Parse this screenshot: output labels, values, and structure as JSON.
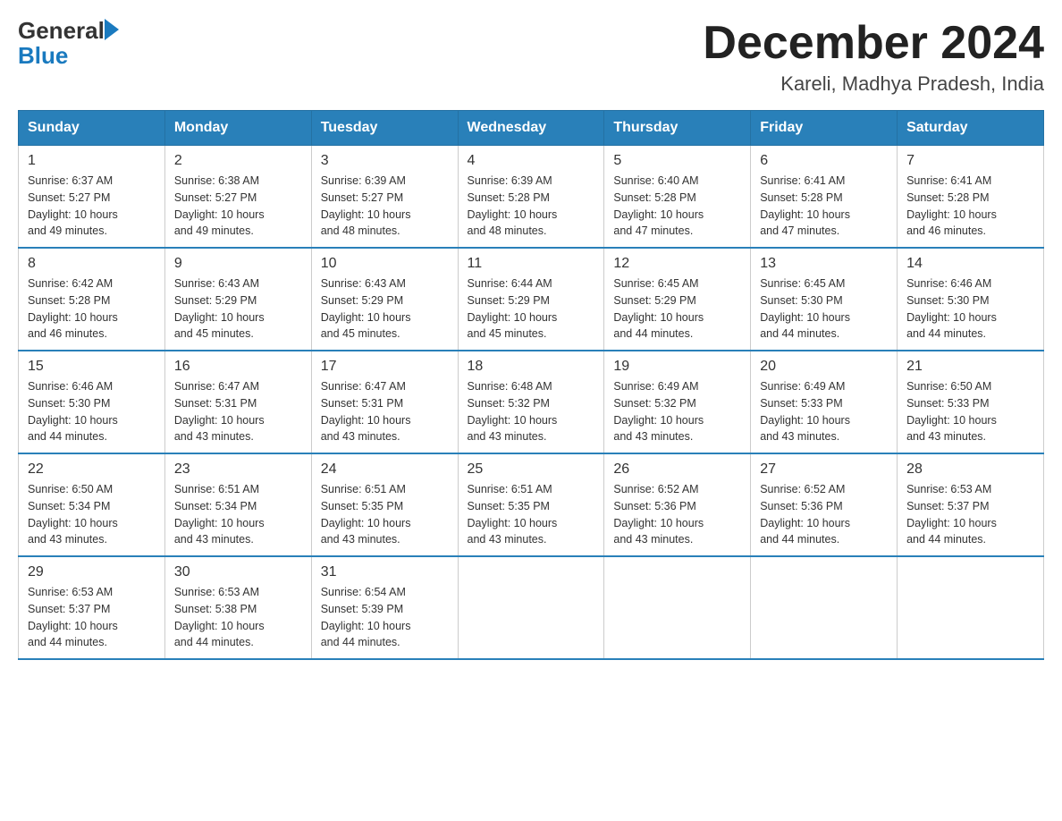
{
  "header": {
    "logo_general": "General",
    "logo_blue": "Blue",
    "month_title": "December 2024",
    "location": "Kareli, Madhya Pradesh, India"
  },
  "days_of_week": [
    "Sunday",
    "Monday",
    "Tuesday",
    "Wednesday",
    "Thursday",
    "Friday",
    "Saturday"
  ],
  "weeks": [
    [
      {
        "day": "1",
        "sunrise": "6:37 AM",
        "sunset": "5:27 PM",
        "daylight": "10 hours and 49 minutes."
      },
      {
        "day": "2",
        "sunrise": "6:38 AM",
        "sunset": "5:27 PM",
        "daylight": "10 hours and 49 minutes."
      },
      {
        "day": "3",
        "sunrise": "6:39 AM",
        "sunset": "5:27 PM",
        "daylight": "10 hours and 48 minutes."
      },
      {
        "day": "4",
        "sunrise": "6:39 AM",
        "sunset": "5:28 PM",
        "daylight": "10 hours and 48 minutes."
      },
      {
        "day": "5",
        "sunrise": "6:40 AM",
        "sunset": "5:28 PM",
        "daylight": "10 hours and 47 minutes."
      },
      {
        "day": "6",
        "sunrise": "6:41 AM",
        "sunset": "5:28 PM",
        "daylight": "10 hours and 47 minutes."
      },
      {
        "day": "7",
        "sunrise": "6:41 AM",
        "sunset": "5:28 PM",
        "daylight": "10 hours and 46 minutes."
      }
    ],
    [
      {
        "day": "8",
        "sunrise": "6:42 AM",
        "sunset": "5:28 PM",
        "daylight": "10 hours and 46 minutes."
      },
      {
        "day": "9",
        "sunrise": "6:43 AM",
        "sunset": "5:29 PM",
        "daylight": "10 hours and 45 minutes."
      },
      {
        "day": "10",
        "sunrise": "6:43 AM",
        "sunset": "5:29 PM",
        "daylight": "10 hours and 45 minutes."
      },
      {
        "day": "11",
        "sunrise": "6:44 AM",
        "sunset": "5:29 PM",
        "daylight": "10 hours and 45 minutes."
      },
      {
        "day": "12",
        "sunrise": "6:45 AM",
        "sunset": "5:29 PM",
        "daylight": "10 hours and 44 minutes."
      },
      {
        "day": "13",
        "sunrise": "6:45 AM",
        "sunset": "5:30 PM",
        "daylight": "10 hours and 44 minutes."
      },
      {
        "day": "14",
        "sunrise": "6:46 AM",
        "sunset": "5:30 PM",
        "daylight": "10 hours and 44 minutes."
      }
    ],
    [
      {
        "day": "15",
        "sunrise": "6:46 AM",
        "sunset": "5:30 PM",
        "daylight": "10 hours and 44 minutes."
      },
      {
        "day": "16",
        "sunrise": "6:47 AM",
        "sunset": "5:31 PM",
        "daylight": "10 hours and 43 minutes."
      },
      {
        "day": "17",
        "sunrise": "6:47 AM",
        "sunset": "5:31 PM",
        "daylight": "10 hours and 43 minutes."
      },
      {
        "day": "18",
        "sunrise": "6:48 AM",
        "sunset": "5:32 PM",
        "daylight": "10 hours and 43 minutes."
      },
      {
        "day": "19",
        "sunrise": "6:49 AM",
        "sunset": "5:32 PM",
        "daylight": "10 hours and 43 minutes."
      },
      {
        "day": "20",
        "sunrise": "6:49 AM",
        "sunset": "5:33 PM",
        "daylight": "10 hours and 43 minutes."
      },
      {
        "day": "21",
        "sunrise": "6:50 AM",
        "sunset": "5:33 PM",
        "daylight": "10 hours and 43 minutes."
      }
    ],
    [
      {
        "day": "22",
        "sunrise": "6:50 AM",
        "sunset": "5:34 PM",
        "daylight": "10 hours and 43 minutes."
      },
      {
        "day": "23",
        "sunrise": "6:51 AM",
        "sunset": "5:34 PM",
        "daylight": "10 hours and 43 minutes."
      },
      {
        "day": "24",
        "sunrise": "6:51 AM",
        "sunset": "5:35 PM",
        "daylight": "10 hours and 43 minutes."
      },
      {
        "day": "25",
        "sunrise": "6:51 AM",
        "sunset": "5:35 PM",
        "daylight": "10 hours and 43 minutes."
      },
      {
        "day": "26",
        "sunrise": "6:52 AM",
        "sunset": "5:36 PM",
        "daylight": "10 hours and 43 minutes."
      },
      {
        "day": "27",
        "sunrise": "6:52 AM",
        "sunset": "5:36 PM",
        "daylight": "10 hours and 44 minutes."
      },
      {
        "day": "28",
        "sunrise": "6:53 AM",
        "sunset": "5:37 PM",
        "daylight": "10 hours and 44 minutes."
      }
    ],
    [
      {
        "day": "29",
        "sunrise": "6:53 AM",
        "sunset": "5:37 PM",
        "daylight": "10 hours and 44 minutes."
      },
      {
        "day": "30",
        "sunrise": "6:53 AM",
        "sunset": "5:38 PM",
        "daylight": "10 hours and 44 minutes."
      },
      {
        "day": "31",
        "sunrise": "6:54 AM",
        "sunset": "5:39 PM",
        "daylight": "10 hours and 44 minutes."
      },
      null,
      null,
      null,
      null
    ]
  ],
  "labels": {
    "sunrise": "Sunrise:",
    "sunset": "Sunset:",
    "daylight": "Daylight:"
  }
}
